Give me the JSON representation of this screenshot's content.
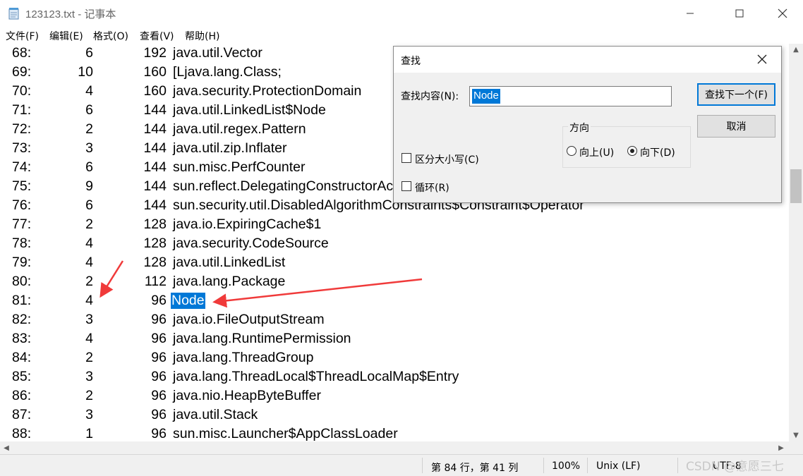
{
  "window": {
    "title": "123123.txt - 记事本",
    "minimize_icon": "minimize-icon",
    "maximize_icon": "maximize-icon",
    "close_icon": "close-icon"
  },
  "menu": [
    "文件(F)",
    "编辑(E)",
    "格式(O)",
    "查看(V)",
    "帮助(H)"
  ],
  "lines": [
    {
      "n": "68:",
      "a": "6",
      "b": "192",
      "cls": "java.util.Vector"
    },
    {
      "n": "69:",
      "a": "10",
      "b": "160",
      "cls": "[Ljava.lang.Class;"
    },
    {
      "n": "70:",
      "a": "4",
      "b": "160",
      "cls": "java.security.ProtectionDomain"
    },
    {
      "n": "71:",
      "a": "6",
      "b": "144",
      "cls": "java.util.LinkedList$Node"
    },
    {
      "n": "72:",
      "a": "2",
      "b": "144",
      "cls": "java.util.regex.Pattern"
    },
    {
      "n": "73:",
      "a": "3",
      "b": "144",
      "cls": "java.util.zip.Inflater"
    },
    {
      "n": "74:",
      "a": "6",
      "b": "144",
      "cls": "sun.misc.PerfCounter"
    },
    {
      "n": "75:",
      "a": "9",
      "b": "144",
      "cls": "sun.reflect.DelegatingConstructorAccessorImpl"
    },
    {
      "n": "76:",
      "a": "6",
      "b": "144",
      "cls": "sun.security.util.DisabledAlgorithmConstraints$Constraint$Operator"
    },
    {
      "n": "77:",
      "a": "2",
      "b": "128",
      "cls": "java.io.ExpiringCache$1"
    },
    {
      "n": "78:",
      "a": "4",
      "b": "128",
      "cls": "java.security.CodeSource"
    },
    {
      "n": "79:",
      "a": "4",
      "b": "128",
      "cls": "java.util.LinkedList"
    },
    {
      "n": "80:",
      "a": "2",
      "b": "112",
      "cls": "java.lang.Package"
    },
    {
      "n": "81:",
      "a": "4",
      "b": "96",
      "cls": "Node",
      "highlight": true
    },
    {
      "n": "82:",
      "a": "3",
      "b": "96",
      "cls": "java.io.FileOutputStream"
    },
    {
      "n": "83:",
      "a": "4",
      "b": "96",
      "cls": "java.lang.RuntimePermission"
    },
    {
      "n": "84:",
      "a": "2",
      "b": "96",
      "cls": "java.lang.ThreadGroup"
    },
    {
      "n": "85:",
      "a": "3",
      "b": "96",
      "cls": "java.lang.ThreadLocal$ThreadLocalMap$Entry"
    },
    {
      "n": "86:",
      "a": "2",
      "b": "96",
      "cls": "java.nio.HeapByteBuffer"
    },
    {
      "n": "87:",
      "a": "3",
      "b": "96",
      "cls": "java.util.Stack"
    },
    {
      "n": "88:",
      "a": "1",
      "b": "96",
      "cls": "sun.misc.Launcher$AppClassLoader"
    }
  ],
  "status": {
    "position": "第 84 行，第 41 列",
    "zoom": "100%",
    "eol": "Unix (LF)",
    "encoding": "UTF-8",
    "watermark": "CSDN @意愿三七"
  },
  "find_dialog": {
    "title": "查找",
    "find_label": "查找内容(N):",
    "find_value": "Node",
    "find_next": "查找下一个(F)",
    "cancel": "取消",
    "direction_label": "方向",
    "up": "向上(U)",
    "down": "向下(D)",
    "direction_selected": "down",
    "match_case": "区分大小写(C)",
    "match_case_checked": false,
    "wrap": "循环(R)",
    "wrap_checked": false
  },
  "colors": {
    "selection": "#0078d7",
    "annotation_arrow": "#f03a3a"
  }
}
